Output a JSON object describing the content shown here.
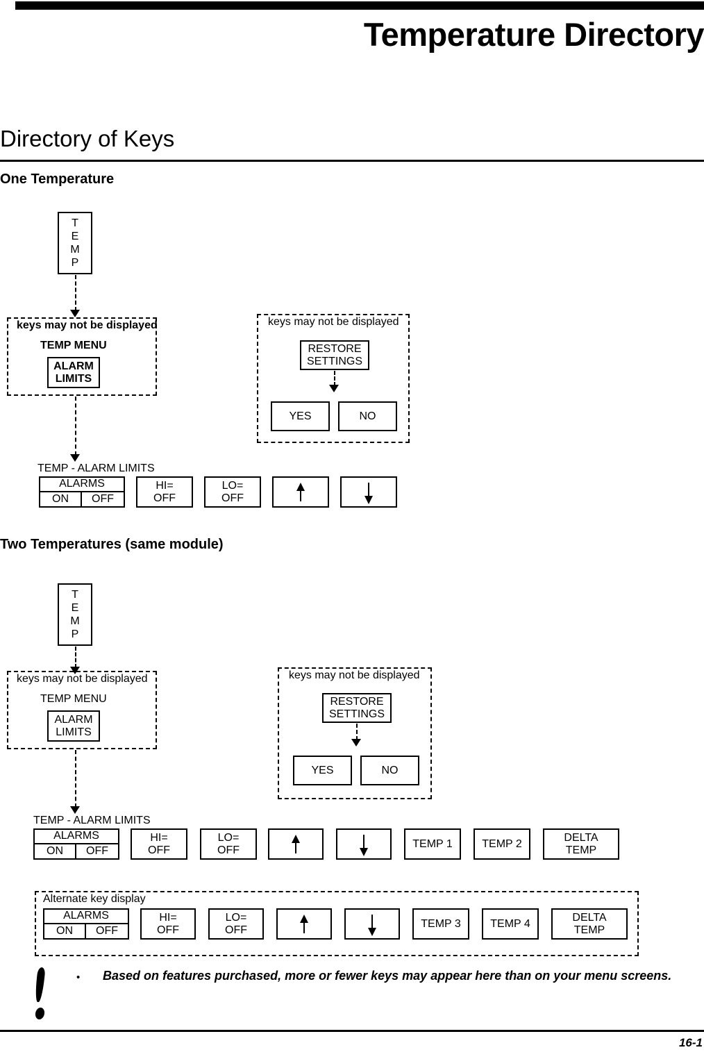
{
  "header": {
    "title": "Temperature Directory",
    "section_title": "Directory of Keys"
  },
  "footer": {
    "page_number": "16-1",
    "note_bullet": "•",
    "note_text": "Based on features purchased, more or fewer keys may appear here than on your menu screens.",
    "warning_icon": "exclamation-icon"
  },
  "sections": [
    {
      "heading": "One Temperature",
      "temp_key": {
        "letters": [
          "T",
          "E",
          "M",
          "P"
        ]
      },
      "menu_group": {
        "caption": "keys may not be displayed",
        "menu_title": "TEMP MENU",
        "key": "ALARM\nLIMITS"
      },
      "restore_group": {
        "caption": "keys may not be displayed",
        "restore_key": "RESTORE\nSETTINGS",
        "yes_key": "YES",
        "no_key": "NO"
      },
      "limits_row": {
        "title": "TEMP - ALARM LIMITS",
        "alarms": {
          "title": "ALARMS",
          "on": "ON",
          "off": "OFF"
        },
        "keys": [
          "HI=\nOFF",
          "LO=\nOFF"
        ],
        "arrow_up": "up-arrow-icon",
        "arrow_down": "down-arrow-icon"
      }
    },
    {
      "heading": "Two Temperatures (same module)",
      "temp_key": {
        "letters": [
          "T",
          "E",
          "M",
          "P"
        ]
      },
      "menu_group": {
        "caption": "keys may not be displayed",
        "menu_title": "TEMP MENU",
        "key": "ALARM\nLIMITS"
      },
      "restore_group": {
        "caption": "keys may not be displayed",
        "restore_key": "RESTORE\nSETTINGS",
        "yes_key": "YES",
        "no_key": "NO"
      },
      "limits_row": {
        "title": "TEMP - ALARM LIMITS",
        "alarms": {
          "title": "ALARMS",
          "on": "ON",
          "off": "OFF"
        },
        "keys": [
          "HI=\nOFF",
          "LO=\nOFF"
        ],
        "arrow_up": "up-arrow-icon",
        "arrow_down": "down-arrow-icon",
        "temp_keys": [
          "TEMP 1",
          "TEMP 2"
        ],
        "delta_key": "DELTA\nTEMP"
      },
      "alternate_row": {
        "caption": "Alternate key display",
        "alarms": {
          "title": "ALARMS",
          "on": "ON",
          "off": "OFF"
        },
        "keys": [
          "HI=\nOFF",
          "LO=\nOFF"
        ],
        "arrow_up": "up-arrow-icon",
        "arrow_down": "down-arrow-icon",
        "temp_keys": [
          "TEMP 3",
          "TEMP 4"
        ],
        "delta_key": "DELTA\nTEMP"
      }
    }
  ]
}
